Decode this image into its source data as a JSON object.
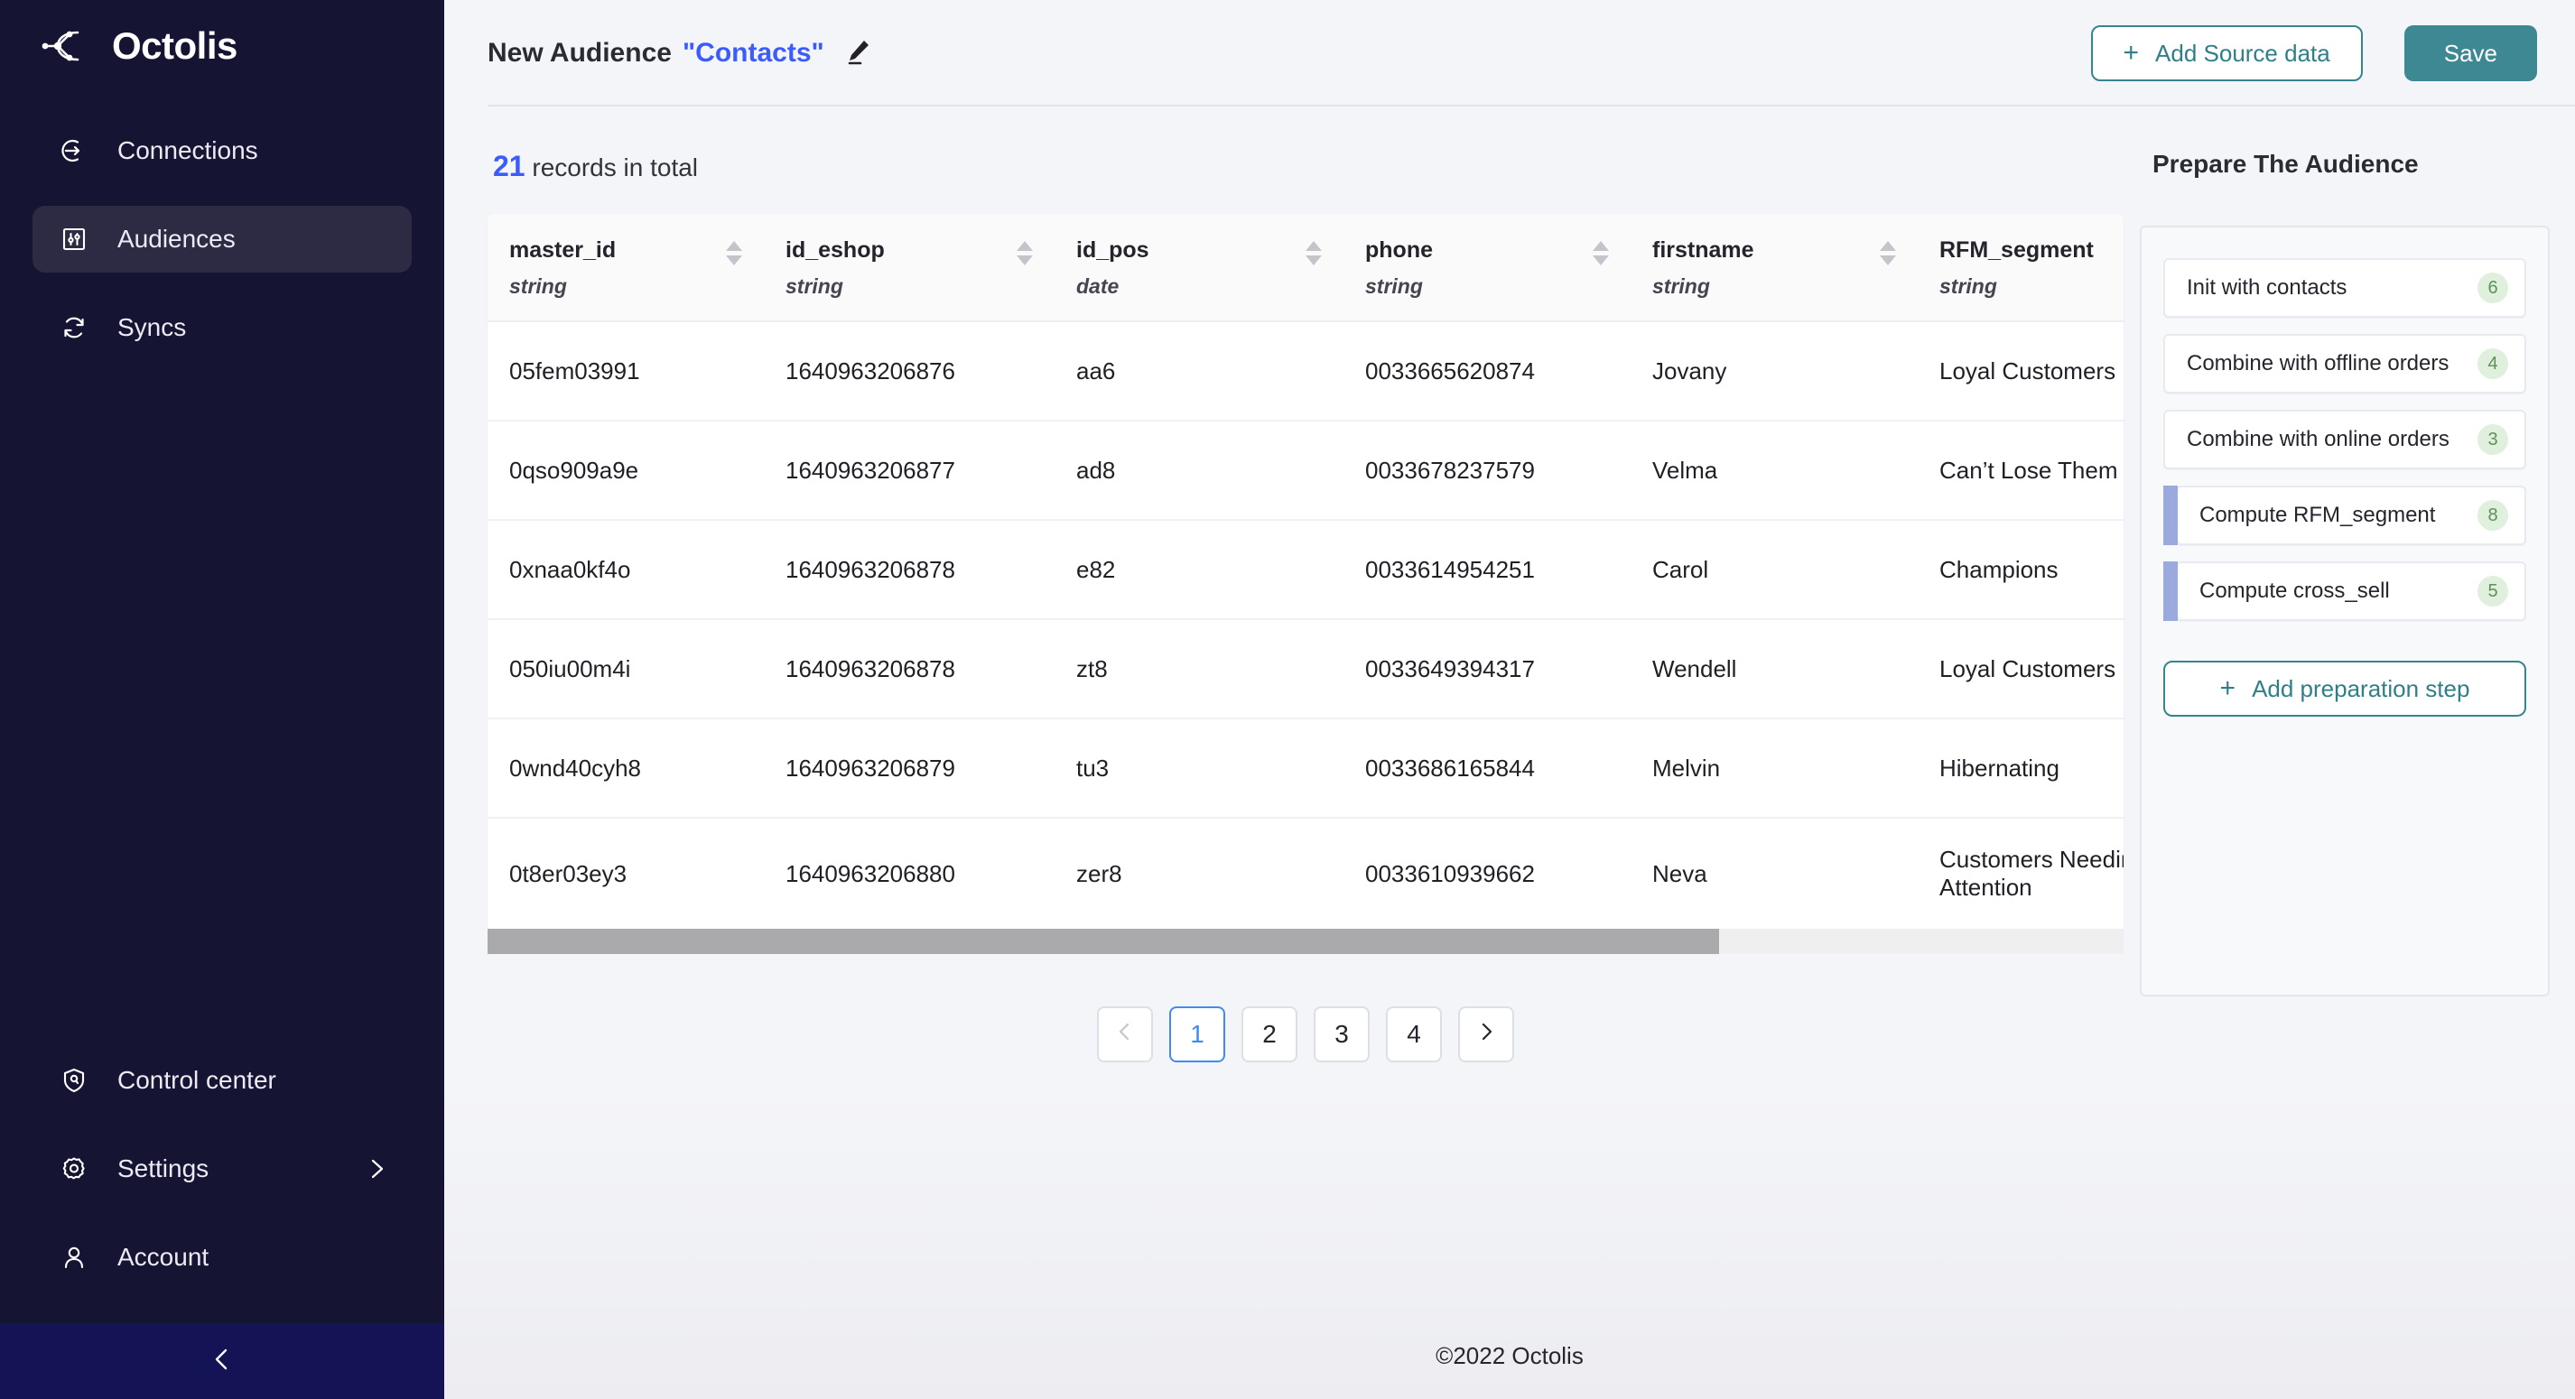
{
  "sidebar": {
    "brand": "Octolis",
    "brand_icon": "octolis-logo-icon",
    "top_items": [
      {
        "label": "Connections",
        "icon": "arrow-into-circle-icon",
        "active": false
      },
      {
        "label": "Audiences",
        "icon": "sliders-square-icon",
        "active": true
      },
      {
        "label": "Syncs",
        "icon": "refresh-circular-icon",
        "active": false
      }
    ],
    "bottom_items": [
      {
        "label": "Control center",
        "icon": "shield-user-icon",
        "chevron": false
      },
      {
        "label": "Settings",
        "icon": "gear-icon",
        "chevron": true
      },
      {
        "label": "Account",
        "icon": "user-icon",
        "chevron": false
      }
    ],
    "collapse_icon": "chevron-left-icon"
  },
  "topbar": {
    "title_prefix": "New Audience",
    "title_quoted": "\"Contacts\"",
    "edit_icon": "pencil-icon",
    "add_source_label": "Add Source data",
    "add_source_icon": "plus-icon",
    "save_label": "Save"
  },
  "records": {
    "count": "21",
    "suffix": "records in total"
  },
  "table": {
    "columns": [
      {
        "name": "master_id",
        "type": "string",
        "sort_icon": "sort-arrows-icon"
      },
      {
        "name": "id_eshop",
        "type": "string",
        "sort_icon": "sort-arrows-icon"
      },
      {
        "name": "id_pos",
        "type": "date",
        "sort_icon": "sort-arrows-icon"
      },
      {
        "name": "phone",
        "type": "string",
        "sort_icon": "sort-arrows-icon"
      },
      {
        "name": "firstname",
        "type": "string",
        "sort_icon": "sort-arrows-icon"
      },
      {
        "name": "RFM_segment",
        "type": "string",
        "sort_icon": "sort-arrows-icon"
      }
    ],
    "rows": [
      [
        "05fem03991",
        "1640963206876",
        "aa6",
        "0033665620874",
        "Jovany",
        "Loyal Customers"
      ],
      [
        "0qso909a9e",
        "1640963206877",
        "ad8",
        "0033678237579",
        "Velma",
        "Can’t Lose Them"
      ],
      [
        "0xnaa0kf4o",
        "1640963206878",
        "e82",
        "0033614954251",
        "Carol",
        "Champions"
      ],
      [
        "050iu00m4i",
        "1640963206878",
        "zt8",
        "0033649394317",
        "Wendell",
        "Loyal Customers"
      ],
      [
        "0wnd40cyh8",
        "1640963206879",
        "tu3",
        "0033686165844",
        "Melvin",
        "Hibernating"
      ],
      [
        "0t8er03ey3",
        "1640963206880",
        "zer8",
        "0033610939662",
        "Neva",
        "Customers Needing Attention"
      ]
    ]
  },
  "pagination": {
    "prev_icon": "chevron-left-icon",
    "next_icon": "chevron-right-icon",
    "pages": [
      "1",
      "2",
      "3",
      "4"
    ],
    "active_page": "1"
  },
  "prepare_panel": {
    "title": "Prepare The Audience",
    "steps": [
      {
        "label": "Init with contacts",
        "badge": "6",
        "accent": false
      },
      {
        "label": "Combine with offline orders",
        "badge": "4",
        "accent": false
      },
      {
        "label": "Combine with online orders",
        "badge": "3",
        "accent": false
      },
      {
        "label": "Compute RFM_segment",
        "badge": "8",
        "accent": true
      },
      {
        "label": "Compute cross_sell",
        "badge": "5",
        "accent": true
      }
    ],
    "add_step_label": "Add preparation step",
    "add_step_icon": "plus-icon"
  },
  "footer": {
    "text": "©2022 Octolis"
  },
  "colors": {
    "sidebar_bg": "#161433",
    "sidebar_active": "#2d2b44",
    "collapse_bg": "#141356",
    "accent_teal": "#3d8893",
    "accent_blue": "#3b5bfd",
    "page_active_blue": "#3f8bf0",
    "badge_green_bg": "#dff0dd",
    "badge_green_text": "#5d9157",
    "step_accent": "#9aaadf",
    "page_bg": "#f4f5f9"
  }
}
